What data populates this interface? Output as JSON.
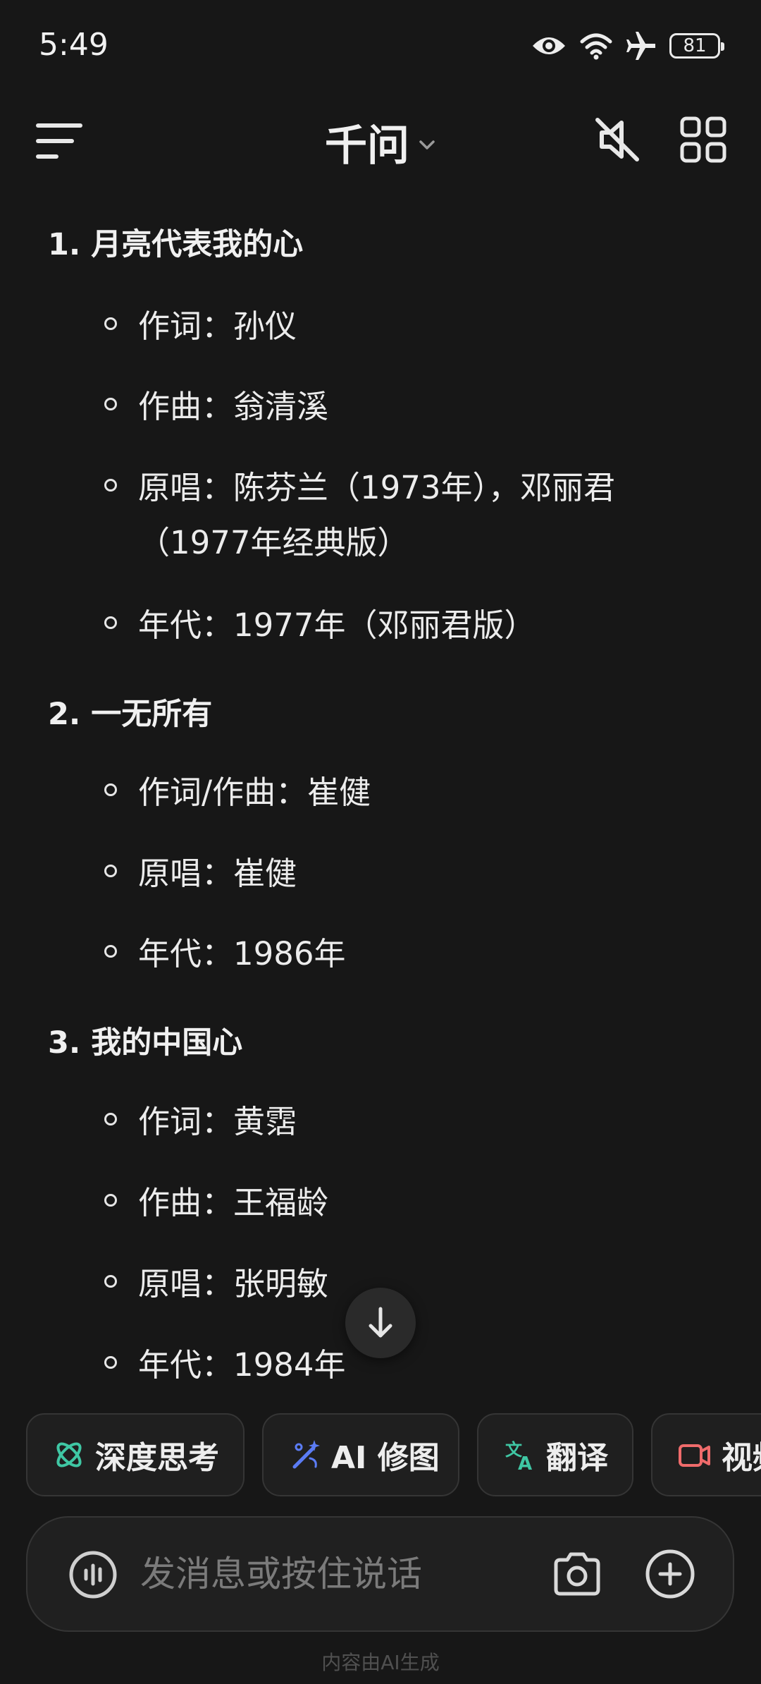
{
  "status_bar": {
    "time": "5:49",
    "battery": "81"
  },
  "header": {
    "title": "千问"
  },
  "songs": [
    {
      "title": "1. 月亮代表我的心",
      "details": [
        "作词：孙仪",
        "作曲：翁清溪",
        "原唱：陈芬兰（1973年），邓丽君（1977年经典版）",
        "年代：1977年（邓丽君版）"
      ]
    },
    {
      "title": "2. 一无所有",
      "details": [
        "作词/作曲：崔健",
        "原唱：崔健",
        "年代：1986年"
      ]
    },
    {
      "title": "3. 我的中国心",
      "details": [
        "作词：黄霑",
        "作曲：王福龄",
        "原唱：张明敏",
        "年代：1984年"
      ]
    }
  ],
  "chips": [
    {
      "label": "深度思考",
      "icon": "atom-icon",
      "color": "#3fc7a4"
    },
    {
      "label": "AI 修图",
      "icon": "magic-wand-icon",
      "color": "#5b7cf5"
    },
    {
      "label": "翻译",
      "icon": "translate-icon",
      "color": "#3fc7a4"
    },
    {
      "label": "视频",
      "icon": "video-icon",
      "color": "#ef6b6b"
    }
  ],
  "input": {
    "placeholder": "发消息或按住说话"
  },
  "footer": "内容由AI生成"
}
